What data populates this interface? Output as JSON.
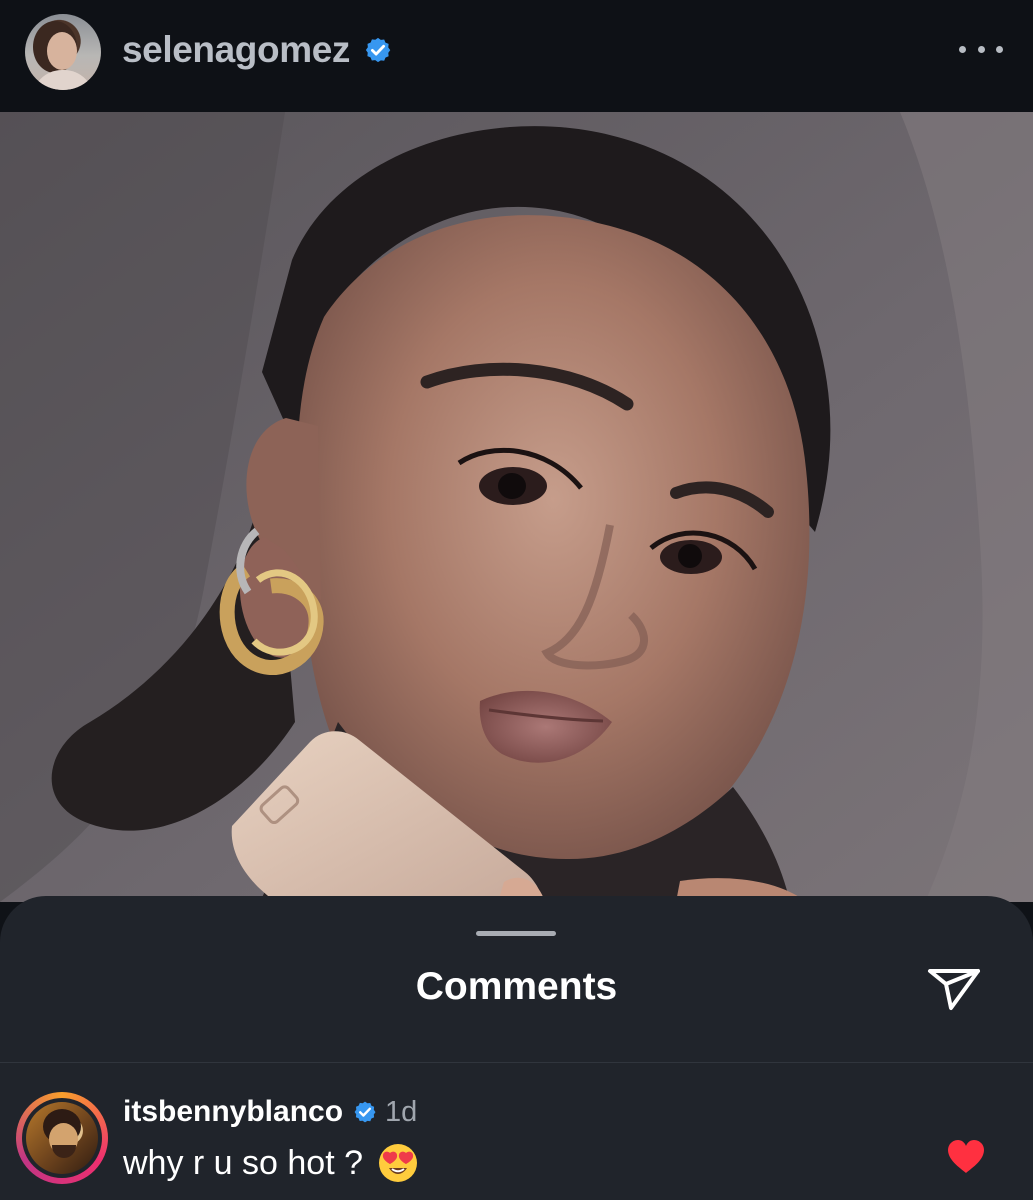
{
  "post": {
    "username": "selenagomez",
    "verified": true
  },
  "comments_sheet": {
    "title": "Comments"
  },
  "comments": [
    {
      "username": "itsbennyblanco",
      "verified": true,
      "time": "1d",
      "text": "why r u so hot ?",
      "emoji": "smiling-face-with-heart-eyes",
      "liked": true
    }
  ],
  "colors": {
    "verified_blue": "#3797f0",
    "like_red": "#ff3040",
    "sheet_background": "#20242b"
  }
}
